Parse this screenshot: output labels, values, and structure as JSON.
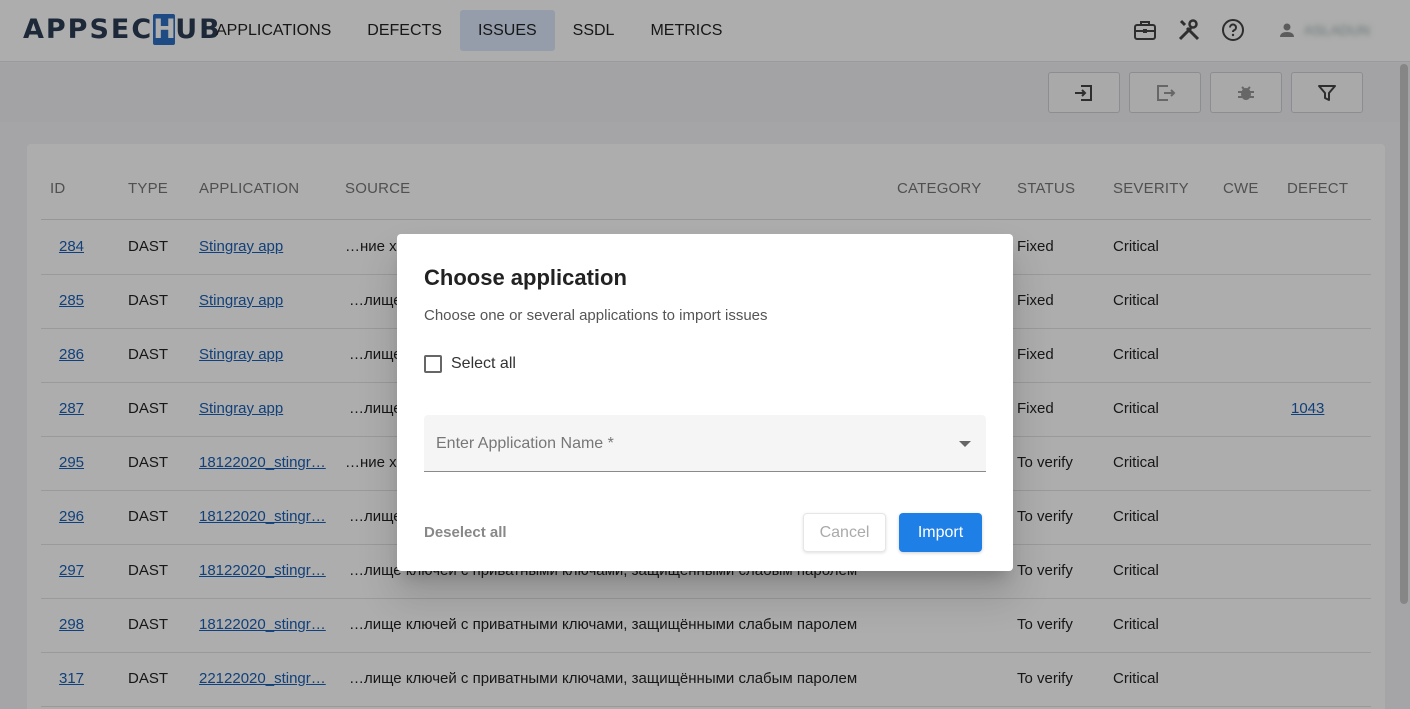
{
  "app": {
    "logo_left": "APPSEC",
    "logo_h": "H",
    "logo_right": "UB"
  },
  "nav": {
    "items": [
      {
        "label": "APPLICATIONS"
      },
      {
        "label": "DEFECTS"
      },
      {
        "label": "ISSUES",
        "active": true
      },
      {
        "label": "SSDL"
      },
      {
        "label": "METRICS"
      }
    ]
  },
  "header_icons": [
    "briefcase-icon",
    "tools-icon",
    "help-icon",
    "user-icon"
  ],
  "user": {
    "name": "ASLADUN"
  },
  "toolbar": {
    "buttons": [
      "import-icon",
      "export-icon",
      "bug-icon",
      "filter-icon"
    ]
  },
  "table": {
    "columns": [
      "ID",
      "TYPE",
      "APPLICATION",
      "SOURCE",
      "CATEGORY",
      "STATUS",
      "SEVERITY",
      "CWE",
      "DEFECT"
    ],
    "rows": [
      {
        "id": "284",
        "type": "DAST",
        "application": "Stingray app",
        "source": "…ние хр",
        "status": "Fixed",
        "severity": "Critical",
        "defect": ""
      },
      {
        "id": "285",
        "type": "DAST",
        "application": "Stingray app",
        "source": "…лище",
        "status": "Fixed",
        "severity": "Critical",
        "defect": ""
      },
      {
        "id": "286",
        "type": "DAST",
        "application": "Stingray app",
        "source": "…лище",
        "status": "Fixed",
        "severity": "Critical",
        "defect": ""
      },
      {
        "id": "287",
        "type": "DAST",
        "application": "Stingray app",
        "source": "…лище",
        "status": "Fixed",
        "severity": "Critical",
        "defect": "1043"
      },
      {
        "id": "295",
        "type": "DAST",
        "application": "18122020_stingr…",
        "source": "…ние хр",
        "status": "To verify",
        "severity": "Critical",
        "defect": ""
      },
      {
        "id": "296",
        "type": "DAST",
        "application": "18122020_stingr…",
        "source": "…лище",
        "status": "To verify",
        "severity": "Critical",
        "defect": ""
      },
      {
        "id": "297",
        "type": "DAST",
        "application": "18122020_stingr…",
        "source": "…лище ключей с приватными ключами, защищёнными слабым паролем",
        "status": "To verify",
        "severity": "Critical",
        "defect": ""
      },
      {
        "id": "298",
        "type": "DAST",
        "application": "18122020_stingr…",
        "source": "…лище ключей с приватными ключами, защищёнными слабым паролем",
        "status": "To verify",
        "severity": "Critical",
        "defect": ""
      },
      {
        "id": "317",
        "type": "DAST",
        "application": "22122020_stingr…",
        "source": "…лище ключей с приватными ключами, защищёнными слабым паролем",
        "status": "To verify",
        "severity": "Critical",
        "defect": ""
      }
    ]
  },
  "modal": {
    "title": "Choose application",
    "subtitle": "Choose one or several applications to import issues",
    "select_all_label": "Select all",
    "select_placeholder": "Enter Application Name *",
    "deselect_label": "Deselect all",
    "cancel_label": "Cancel",
    "import_label": "Import"
  },
  "colors": {
    "accent": "#1e7fe6",
    "nav_active_bg": "#dce8fb",
    "link": "#1a5fb4",
    "logo": "#2b3d55"
  }
}
